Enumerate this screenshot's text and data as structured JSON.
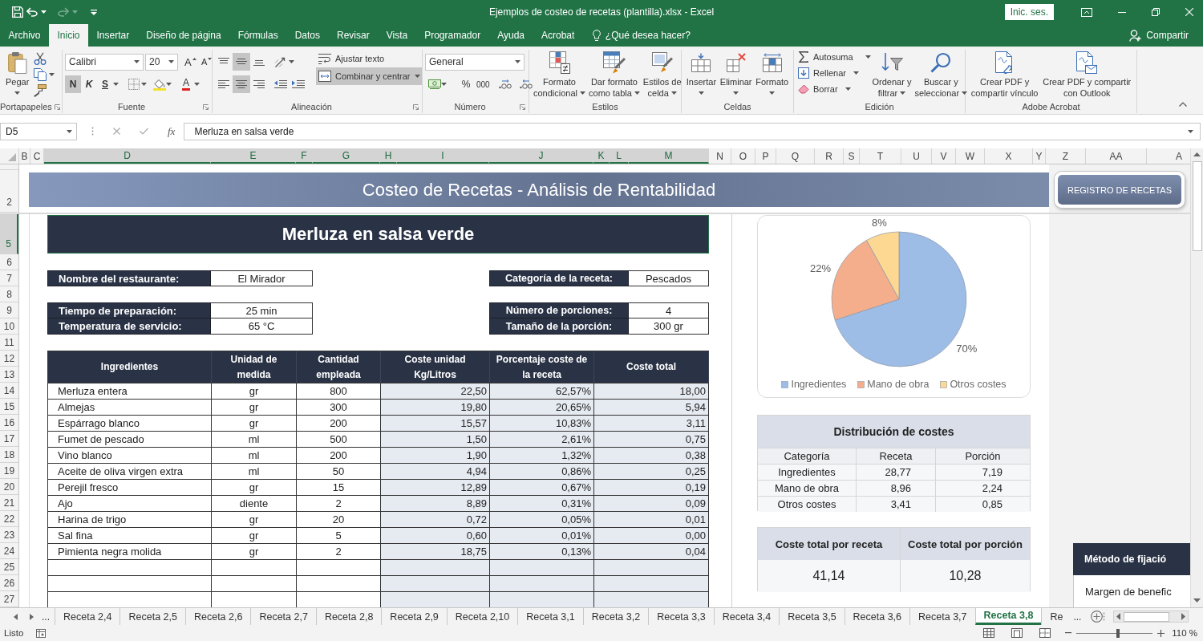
{
  "window": {
    "title": "Ejemplos de costeo de recetas (plantilla).xlsx - Excel",
    "sign_in": "Inic. ses."
  },
  "quick_access": [
    {
      "kind": "save",
      "disabled": false
    },
    {
      "kind": "undo",
      "disabled": false
    },
    {
      "kind": "redo",
      "disabled": true
    }
  ],
  "menu_tabs": [
    {
      "label": "Archivo",
      "selected": false
    },
    {
      "label": "Inicio",
      "selected": true
    },
    {
      "label": "Insertar",
      "selected": false
    },
    {
      "label": "Diseño de página",
      "selected": false
    },
    {
      "label": "Fórmulas",
      "selected": false
    },
    {
      "label": "Datos",
      "selected": false
    },
    {
      "label": "Revisar",
      "selected": false
    },
    {
      "label": "Vista",
      "selected": false
    },
    {
      "label": "Programador",
      "selected": false
    },
    {
      "label": "Ayuda",
      "selected": false
    },
    {
      "label": "Acrobat",
      "selected": false
    }
  ],
  "tell_me": "¿Qué desea hacer?",
  "share": "Compartir",
  "ribbon": {
    "clipboard": {
      "label": "Portapapeles",
      "paste": "Pegar"
    },
    "font": {
      "label": "Fuente",
      "family": "Calibri",
      "size": "20",
      "grow": "A",
      "shrink": "A",
      "styles": [
        {
          "label": "N",
          "selected": true
        },
        {
          "label": "K",
          "selected": false
        },
        {
          "label": "S",
          "selected": false
        }
      ],
      "font_color": "A"
    },
    "alignment": {
      "label": "Alineación",
      "vertical": [
        {
          "selected": false
        },
        {
          "selected": true
        },
        {
          "selected": false
        }
      ],
      "horizontal": [
        {
          "selected": false
        },
        {
          "selected": true
        },
        {
          "selected": false
        }
      ],
      "wrap": {
        "label": "Ajustar texto",
        "selected": false
      },
      "merge": {
        "label": "Combinar y centrar",
        "selected": true
      }
    },
    "number": {
      "label": "Número",
      "format": "General",
      "percent": "%",
      "thousands": "000"
    },
    "styles": {
      "label": "Estilos",
      "buttons": [
        {
          "lines": [
            "Formato",
            "condicional"
          ],
          "dropdown": true
        },
        {
          "lines": [
            "Dar formato",
            "como tabla"
          ],
          "dropdown": true
        },
        {
          "lines": [
            "Estilos de",
            "celda"
          ],
          "dropdown": true
        }
      ]
    },
    "cells": {
      "label": "Celdas",
      "buttons": [
        {
          "lines": [
            "Insertar"
          ],
          "dropdown": true
        },
        {
          "lines": [
            "Eliminar"
          ],
          "dropdown": true
        },
        {
          "lines": [
            "Formato"
          ],
          "dropdown": true
        }
      ]
    },
    "editing": {
      "label": "Edición",
      "small": [
        {
          "label": "Autosuma",
          "dropdown": true
        },
        {
          "label": "Rellenar",
          "dropdown": true
        },
        {
          "label": "Borrar",
          "dropdown": true
        }
      ],
      "buttons": [
        {
          "lines": [
            "Ordenar y",
            "filtrar"
          ],
          "dropdown": true
        },
        {
          "lines": [
            "Buscar y",
            "seleccionar"
          ],
          "dropdown": true
        }
      ]
    },
    "acrobat": {
      "label": "Adobe Acrobat",
      "buttons": [
        {
          "lines": [
            "Crear PDF y",
            "compartir vínculo"
          ],
          "dropdown": false
        },
        {
          "lines": [
            "Crear PDF y compartir",
            "con Outlook"
          ],
          "dropdown": false
        }
      ]
    }
  },
  "formula_bar": {
    "name_box": "D5",
    "function_label": "fx",
    "content": "Merluza en salsa verde"
  },
  "columns": [
    {
      "label": "B",
      "selected": false
    },
    {
      "label": "C",
      "selected": false
    },
    {
      "label": "D",
      "selected": true
    },
    {
      "label": "E",
      "selected": true
    },
    {
      "label": "F",
      "selected": true
    },
    {
      "label": "G",
      "selected": true
    },
    {
      "label": "H",
      "selected": true
    },
    {
      "label": "I",
      "selected": true
    },
    {
      "label": "J",
      "selected": true
    },
    {
      "label": "K",
      "selected": true
    },
    {
      "label": "L",
      "selected": true
    },
    {
      "label": "M",
      "selected": true
    },
    {
      "label": "N",
      "selected": false
    },
    {
      "label": "O",
      "selected": false
    },
    {
      "label": "P",
      "selected": false
    },
    {
      "label": "Q",
      "selected": false
    },
    {
      "label": "R",
      "selected": false
    },
    {
      "label": "S",
      "selected": false
    },
    {
      "label": "T",
      "selected": false
    },
    {
      "label": "U",
      "selected": false
    },
    {
      "label": "V",
      "selected": false
    },
    {
      "label": "W",
      "selected": false
    },
    {
      "label": "X",
      "selected": false
    },
    {
      "label": "Y",
      "selected": false
    },
    {
      "label": "Z",
      "selected": false
    },
    {
      "label": "AA",
      "selected": false
    },
    {
      "label": "A",
      "selected": false
    }
  ],
  "rows": [
    {
      "label": "2",
      "selected": false
    },
    {
      "label": "5",
      "selected": true
    },
    {
      "label": "6",
      "selected": false
    },
    {
      "label": "7",
      "selected": false
    },
    {
      "label": "8",
      "selected": false
    },
    {
      "label": "9",
      "selected": false
    },
    {
      "label": "10",
      "selected": false
    },
    {
      "label": "11",
      "selected": false
    },
    {
      "label": "12",
      "selected": false
    },
    {
      "label": "13",
      "selected": false
    },
    {
      "label": "14",
      "selected": false
    },
    {
      "label": "15",
      "selected": false
    },
    {
      "label": "16",
      "selected": false
    },
    {
      "label": "17",
      "selected": false
    },
    {
      "label": "18",
      "selected": false
    },
    {
      "label": "19",
      "selected": false
    },
    {
      "label": "20",
      "selected": false
    },
    {
      "label": "21",
      "selected": false
    },
    {
      "label": "22",
      "selected": false
    },
    {
      "label": "23",
      "selected": false
    },
    {
      "label": "24",
      "selected": false
    },
    {
      "label": "25",
      "selected": false
    },
    {
      "label": "26",
      "selected": false
    },
    {
      "label": "27",
      "selected": false
    }
  ],
  "sheet": {
    "banner": {
      "title": "Costeo de Recetas - Análisis de Rentabilidad",
      "button": "REGISTRO DE RECETAS"
    },
    "recipe_title": "Merluza en salsa verde",
    "details": [
      {
        "left": [
          {
            "label": "Nombre del restaurante:",
            "value": "El Mirador"
          }
        ],
        "right": [
          {
            "label": "Categoría de la receta:",
            "value": "Pescados"
          }
        ]
      },
      {
        "left": [
          {
            "label": "Tiempo de preparación:",
            "value": "25 min"
          },
          {
            "label": "Temperatura de servicio:",
            "value": "65 °C"
          }
        ],
        "right": [
          {
            "label": "Número de porciones:",
            "value": "4"
          },
          {
            "label": "Tamaño de la porción:",
            "value": "300 gr"
          }
        ]
      }
    ],
    "ingredients": {
      "columns": [
        "Ingredientes",
        "Unidad de medida",
        "Cantidad empleada",
        "Coste unidad Kg/Litros",
        "Porcentaje coste de la receta",
        "Coste total"
      ],
      "rows": [
        [
          "Merluza entera",
          "gr",
          "800",
          "22,50",
          "62,57%",
          "18,00"
        ],
        [
          "Almejas",
          "gr",
          "300",
          "19,80",
          "20,65%",
          "5,94"
        ],
        [
          "Espárrago blanco",
          "gr",
          "200",
          "15,57",
          "10,83%",
          "3,11"
        ],
        [
          "Fumet de pescado",
          "ml",
          "500",
          "1,50",
          "2,61%",
          "0,75"
        ],
        [
          "Vino blanco",
          "ml",
          "200",
          "1,90",
          "1,32%",
          "0,38"
        ],
        [
          "Aceite de oliva virgen extra",
          "ml",
          "50",
          "4,94",
          "0,86%",
          "0,25"
        ],
        [
          "Perejil fresco",
          "gr",
          "15",
          "12,89",
          "0,67%",
          "0,19"
        ],
        [
          "Ajo",
          "diente",
          "2",
          "8,89",
          "0,31%",
          "0,09"
        ],
        [
          "Harina de trigo",
          "gr",
          "20",
          "0,72",
          "0,05%",
          "0,01"
        ],
        [
          "Sal fina",
          "gr",
          "5",
          "0,60",
          "0,01%",
          "0,00"
        ],
        [
          "Pimienta negra molida",
          "gr",
          "2",
          "18,75",
          "0,13%",
          "0,04"
        ]
      ]
    },
    "cost_chart": {
      "chart_data": {
        "type": "pie",
        "categories": [
          "Ingredientes",
          "Mano de obra",
          "Otros costes"
        ],
        "values": [
          70,
          22,
          8
        ],
        "colors": [
          "#9dbde6",
          "#f4ae8c",
          "#fcd892"
        ],
        "value_labels": [
          "70%",
          "22%",
          "8%"
        ],
        "legend": "bottom"
      }
    },
    "distribution": {
      "title": "Distribución de costes",
      "columns": [
        "Categoría",
        "Receta",
        "Porción"
      ],
      "rows": [
        [
          "Ingredientes",
          "28,77",
          "7,19"
        ],
        [
          "Mano de obra",
          "8,96",
          "2,24"
        ],
        [
          "Otros costes",
          "3,41",
          "0,85"
        ]
      ]
    },
    "totals": {
      "columns": [
        "Coste total por receta",
        "Coste total por porción"
      ],
      "values": [
        "41,14",
        "10,28"
      ]
    },
    "pricing": {
      "title": "Método de fijació",
      "rows": [
        "Margen de benefic"
      ]
    }
  },
  "sheet_tabs": {
    "more_left": "...",
    "tabs": [
      {
        "label": "Receta 2,4",
        "selected": false
      },
      {
        "label": "Receta 2,5",
        "selected": false
      },
      {
        "label": "Receta 2,6",
        "selected": false
      },
      {
        "label": "Receta 2,7",
        "selected": false
      },
      {
        "label": "Receta 2,8",
        "selected": false
      },
      {
        "label": "Receta 2,9",
        "selected": false
      },
      {
        "label": "Receta 2,10",
        "selected": false
      },
      {
        "label": "Receta 3,1",
        "selected": false
      },
      {
        "label": "Receta 3,2",
        "selected": false
      },
      {
        "label": "Receta 3,3",
        "selected": false
      },
      {
        "label": "Receta 3,4",
        "selected": false
      },
      {
        "label": "Receta 3,5",
        "selected": false
      },
      {
        "label": "Receta 3,6",
        "selected": false
      },
      {
        "label": "Receta 3,7",
        "selected": false
      },
      {
        "label": "Receta 3,8",
        "selected": true
      },
      {
        "label": "Re",
        "selected": false
      }
    ],
    "more_right": "..."
  },
  "status": {
    "text": "Listo",
    "zoom": {
      "label": "110 %",
      "level": 0.54
    }
  }
}
